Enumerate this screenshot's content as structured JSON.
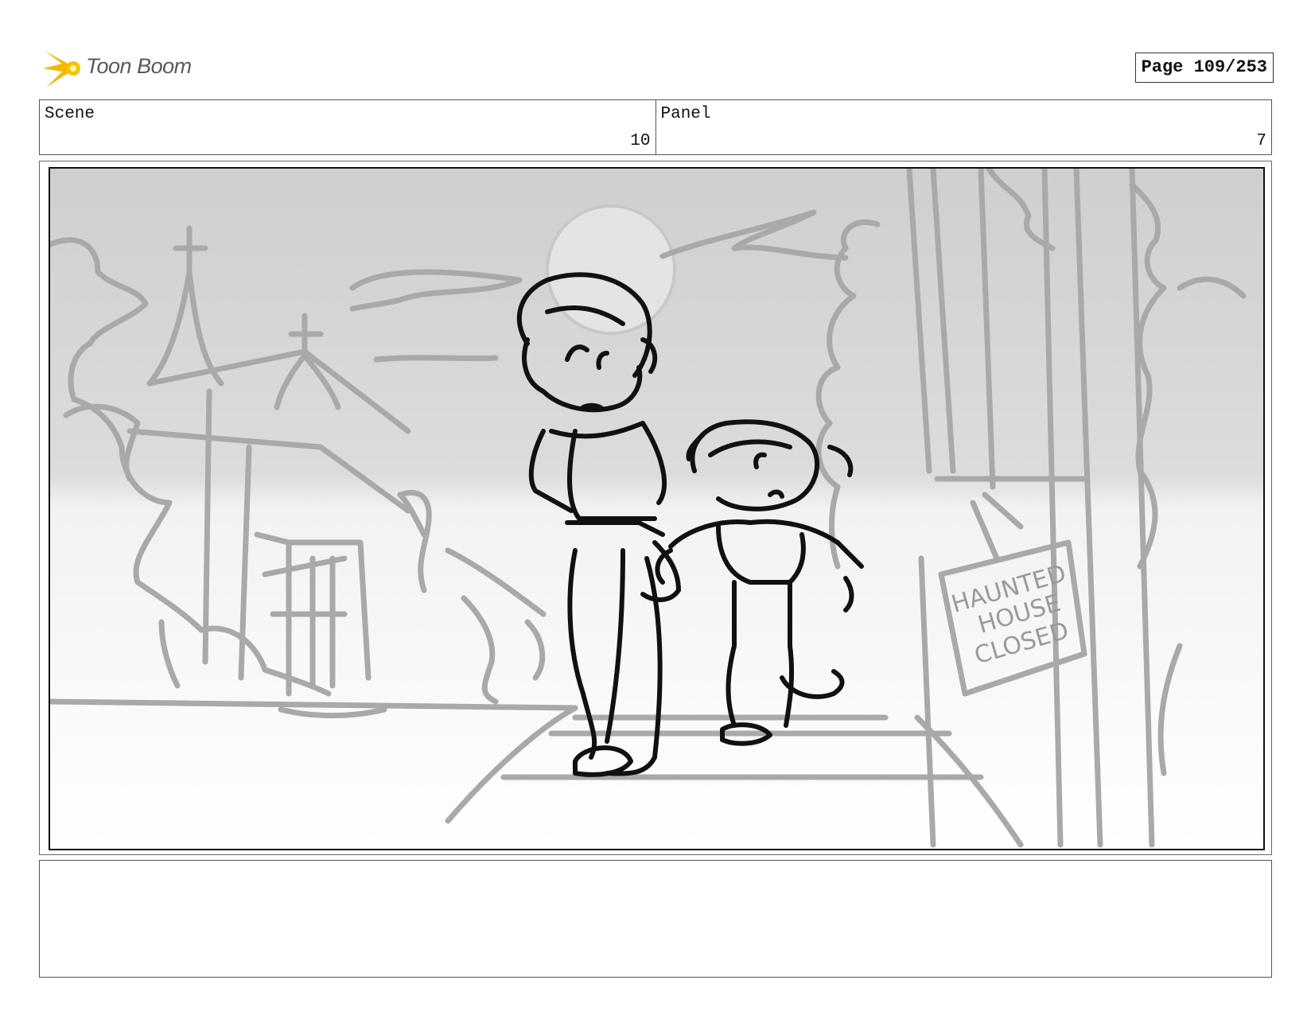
{
  "header": {
    "logo_text": "Toon Boom",
    "page_label": "Page 109/253"
  },
  "scene": {
    "label": "Scene",
    "value": "10"
  },
  "panel": {
    "label": "Panel",
    "value": "7"
  },
  "sign_text": [
    "HAUNTED",
    "HOUSE",
    "CLOSED"
  ],
  "notes": ""
}
